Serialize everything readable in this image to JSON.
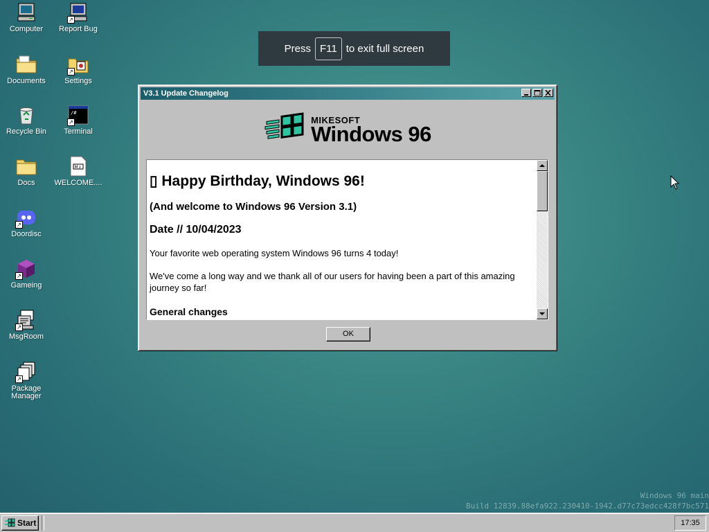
{
  "desktop": {
    "icons": [
      {
        "label": "Computer",
        "icon": "computer-icon"
      },
      {
        "label": "Report Bug",
        "icon": "report-bug-icon"
      },
      {
        "label": "Documents",
        "icon": "documents-folder-icon"
      },
      {
        "label": "Settings",
        "icon": "settings-icon"
      },
      {
        "label": "Recycle Bin",
        "icon": "recycle-bin-icon"
      },
      {
        "label": "Terminal",
        "icon": "terminal-icon"
      },
      {
        "label": "Docs",
        "icon": "folder-icon"
      },
      {
        "label": "WELCOME....",
        "icon": "markdown-file-icon"
      },
      {
        "label": "Doordisc",
        "icon": "doordisc-icon"
      },
      {
        "label": "Gameing",
        "icon": "gameing-cube-icon"
      },
      {
        "label": "MsgRoom",
        "icon": "msgroom-icon"
      },
      {
        "label": "Package Manager",
        "icon": "package-manager-icon"
      }
    ]
  },
  "banner": {
    "press": "Press",
    "key": "F11",
    "suffix": "to exit full screen"
  },
  "window": {
    "title": "V3.1 Update Changelog",
    "logo_small": "MIKESOFT",
    "logo_big": "Windows 96",
    "content": {
      "heading": "▯ Happy Birthday, Windows 96!",
      "subheading": "(And welcome to Windows 96 Version 3.1)",
      "date": "Date // 10/04/2023",
      "para1": "Your favorite web operating system Windows 96 turns 4 today!",
      "para2": "We've come a long way and we thank all of our users for having been a part of this amazing journey so far!",
      "section": "General changes"
    },
    "ok_label": "OK"
  },
  "build_info": {
    "line1": "Windows 96 main",
    "line2": "Build 12839.88efa922.230410-1942.d77c73edcc428f7bc571"
  },
  "taskbar": {
    "start_label": "Start",
    "clock": "17:35"
  },
  "colors": {
    "titlebar_start": "#1b5e6b",
    "titlebar_end": "#57a3a8",
    "desktop": "#3a8684",
    "logo_accent": "#2ec4a0"
  }
}
